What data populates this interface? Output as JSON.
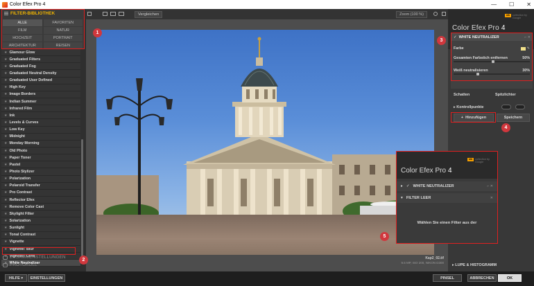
{
  "window": {
    "title": "Color Efex Pro 4",
    "controls": [
      "—",
      "☐",
      "✕"
    ]
  },
  "library": {
    "title": "FILTER-BIBLIOTHEK",
    "categories": [
      "ALLE",
      "FAVORITEN",
      "FILM",
      "NATUR",
      "HOCHZEIT",
      "PORTRAIT",
      "ARCHITEKTUR",
      "REISEN"
    ],
    "filters": [
      "Glamour Glow",
      "Graduated Filters",
      "Graduated Fog",
      "Graduated Neutral Density",
      "Graduated User Defined",
      "High Key",
      "Image Borders",
      "Indian Summer",
      "Infrared Film",
      "Ink",
      "Levels & Curves",
      "Low Key",
      "Midnight",
      "Monday Morning",
      "Old Photo",
      "Paper Toner",
      "Pastel",
      "Photo Stylizer",
      "Polarization",
      "Polaroid Transfer",
      "Pro Contrast",
      "Reflector Efex",
      "Remove Color Cast",
      "Skylight Filter",
      "Solarization",
      "Sunlight",
      "Tonal Contrast",
      "Vignette",
      "Vignette: Blur",
      "Vignette: Lens",
      "White Neutralizer"
    ],
    "selected_filter": "White Neutralizer",
    "sections": [
      "ZUSAMMENSTELLUNGEN",
      "PROTOKOLL"
    ]
  },
  "toolbar": {
    "compare_label": "Vergleichen",
    "zoom_label": "Zoom (100 %)"
  },
  "photo": {
    "filename": "Kap2_02.tif",
    "info": "9.5 MP, ISO 200, NIKON D300"
  },
  "right": {
    "brand": "nik",
    "brand_sub": "collection by Google",
    "app_name": "Color Efex Pro",
    "app_version": "4",
    "card_title": "WHITE NEUTRALIZER",
    "controls": [
      {
        "label": "Farbe",
        "value": ""
      },
      {
        "label": "Gesamten Farbstich entfernen",
        "value": "50%",
        "level": 0.5
      },
      {
        "label": "Weiß neutralisieren",
        "value": "30%",
        "level": 0.3
      }
    ],
    "shadows": "Schatten",
    "highlights": "Spitzlichter",
    "control_points": "Kontrollpunkte",
    "add_label": "Hinzufügen",
    "save_label": "Speichern",
    "loupe": "LUPE & HISTOGRAMM"
  },
  "inset": {
    "app_name": "Color Efex Pro",
    "app_version": "4",
    "row1": "WHITE NEUTRALIZER",
    "row2": "FILTER LEER",
    "message": "Wählen Sie einen Filter aus der"
  },
  "bottom": {
    "help": "HILFE",
    "settings": "EINSTELLUNGEN",
    "brush": "PINSEL",
    "cancel": "ABBRECHEN",
    "ok": "OK"
  },
  "callouts": [
    "1",
    "2",
    "3",
    "4",
    "5"
  ],
  "colors": {
    "accent": "#f0b400",
    "highlight": "#e02020",
    "callout": "#d0373d"
  }
}
